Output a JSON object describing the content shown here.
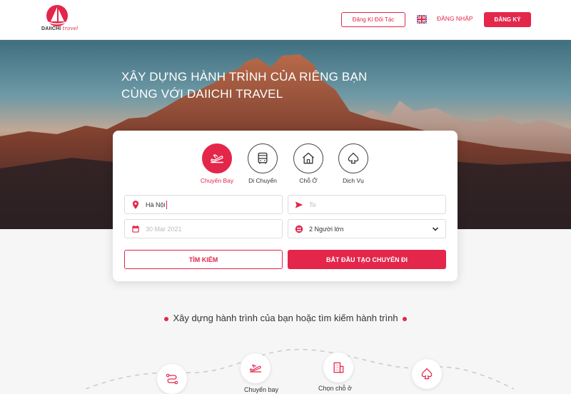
{
  "header": {
    "logo_brand": "DAIICHI",
    "logo_sub": "travel",
    "partner_label": "Đăng Kí Đối Tác",
    "login_label": "ĐĂNG NHẬP",
    "register_label": "ĐĂNG KÝ",
    "language_icon": "uk-flag-icon"
  },
  "hero": {
    "title_line1": "XÂY DỰNG HÀNH TRÌNH CỦA RIÊNG BẠN",
    "title_line2": "CÙNG VỚI DAIICHI TRAVEL"
  },
  "booking": {
    "tabs": [
      {
        "label": "Chuyến Bay",
        "icon": "plane-takeoff-icon",
        "active": true
      },
      {
        "label": "Di Chuyển",
        "icon": "bus-icon",
        "active": false
      },
      {
        "label": "Chỗ Ở",
        "icon": "house-icon",
        "active": false
      },
      {
        "label": "Dịch Vụ",
        "icon": "spade-icon",
        "active": false
      }
    ],
    "from_value": "Hà Nội",
    "to_placeholder": "To",
    "date_placeholder": "30 Mar 2021",
    "guests_value": "2 Người lớn",
    "search_label": "TÌM KIẾM",
    "create_label": "BẮT ĐẦU TẠO CHUYẾN ĐI"
  },
  "section": {
    "title": "Xây dựng hành trình của bạn hoặc tìm kiếm hành trình",
    "steps": [
      {
        "icon": "route-icon"
      },
      {
        "icon": "plane-takeoff-icon",
        "label": "Chuyến bay"
      },
      {
        "icon": "building-icon",
        "label": "Chọn chỗ ở"
      },
      {
        "icon": "spade-icon"
      }
    ]
  },
  "colors": {
    "accent": "#e3264a"
  }
}
